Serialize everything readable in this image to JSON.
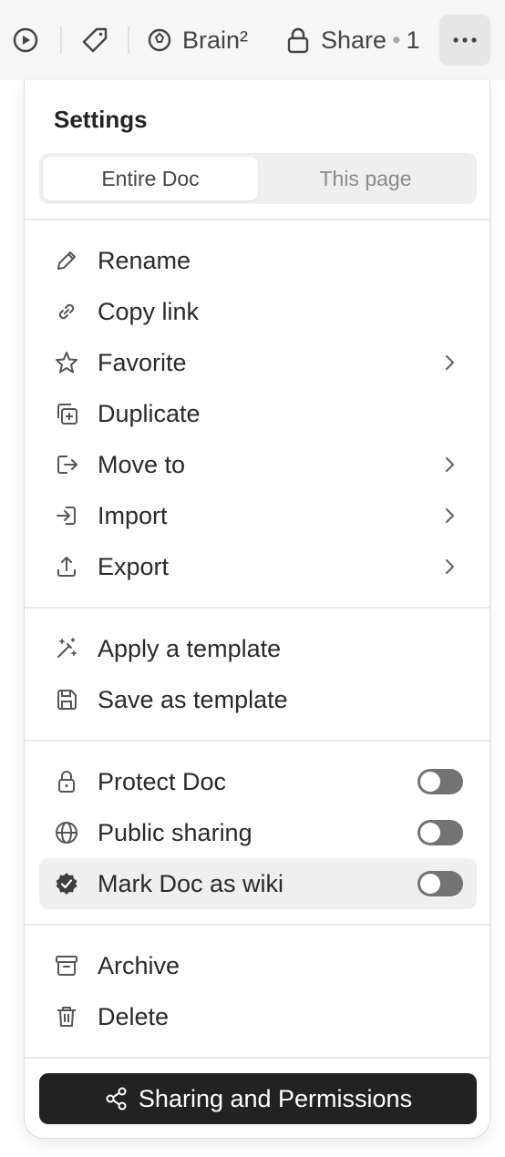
{
  "topbar": {
    "brain_label": "Brain²",
    "share_label": "Share",
    "share_count": "1"
  },
  "menu": {
    "title": "Settings",
    "scope_tabs": [
      {
        "label": "Entire Doc",
        "active": true
      },
      {
        "label": "This page",
        "active": false
      }
    ],
    "items": {
      "rename": "Rename",
      "copy_link": "Copy link",
      "favorite": "Favorite",
      "duplicate": "Duplicate",
      "move_to": "Move to",
      "import": "Import",
      "export": "Export",
      "apply_template": "Apply a template",
      "save_template": "Save as template",
      "protect_doc": "Protect Doc",
      "public_sharing": "Public sharing",
      "mark_wiki": "Mark Doc as wiki",
      "archive": "Archive",
      "delete": "Delete"
    },
    "toggles": {
      "protect_doc": false,
      "public_sharing": false,
      "mark_wiki": false
    },
    "primary_button": "Sharing and Permissions"
  },
  "icons": {
    "play": "play-circle-icon",
    "tag": "tag-icon",
    "brain": "brain-icon",
    "lock": "lock-icon",
    "more": "more-horizontal-icon"
  },
  "colors": {
    "toolbar_bg": "#f6f6f6",
    "primary_button_bg": "#222222",
    "toggle_off": "#737373",
    "highlight_row": "#efefef"
  }
}
